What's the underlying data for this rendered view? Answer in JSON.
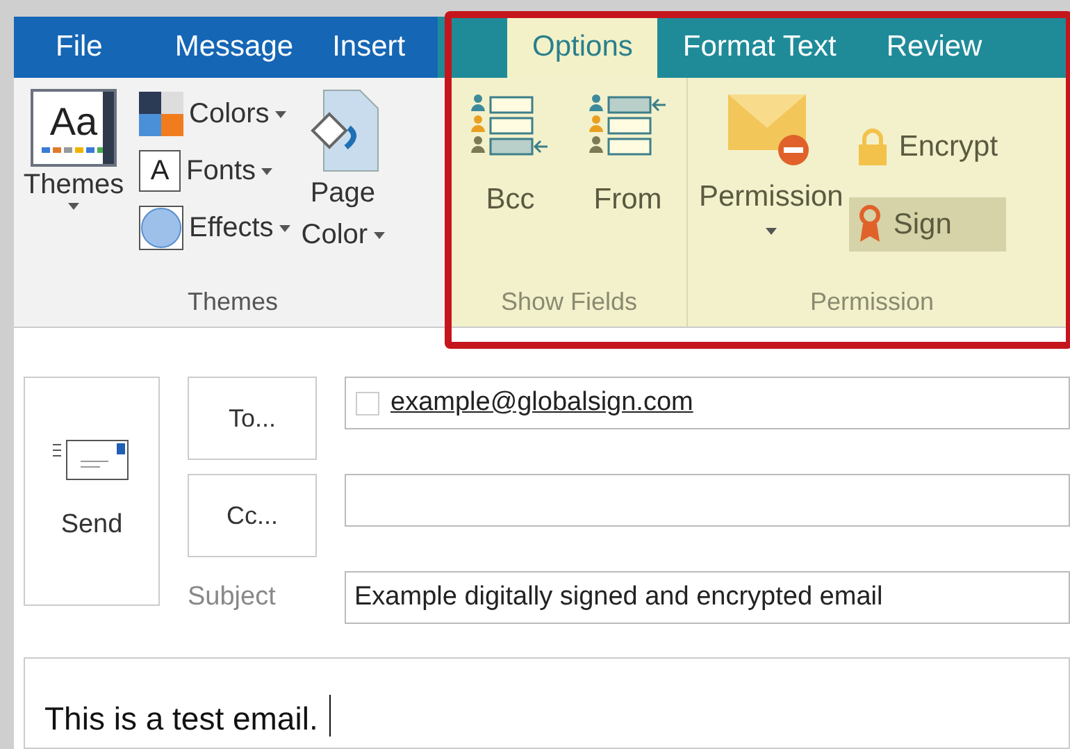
{
  "tabs": [
    {
      "label": "File",
      "selected": false,
      "kind": "main"
    },
    {
      "label": "Message",
      "selected": false,
      "kind": "main"
    },
    {
      "label": "Insert",
      "selected": false,
      "kind": "main"
    },
    {
      "label": "Options",
      "selected": true,
      "kind": "contextual"
    },
    {
      "label": "Format Text",
      "selected": false,
      "kind": "contextual"
    },
    {
      "label": "Review",
      "selected": false,
      "kind": "contextual"
    }
  ],
  "ribbon": {
    "themes_group": {
      "label": "Themes",
      "themes_button": {
        "label": "Themes",
        "icon_text": "Aa"
      },
      "small_buttons": [
        {
          "kind": "colors",
          "label": "Colors"
        },
        {
          "kind": "fonts",
          "label": "Fonts",
          "icon_text": "A"
        },
        {
          "kind": "effects",
          "label": "Effects"
        }
      ],
      "page_color": {
        "label_lines": [
          "Page",
          "Color"
        ]
      }
    },
    "show_fields": {
      "label": "Show Fields",
      "buttons": [
        {
          "kind": "bcc",
          "label": "Bcc"
        },
        {
          "kind": "from",
          "label": "From"
        }
      ]
    },
    "permission": {
      "label": "Permission",
      "permission_button": {
        "label": "Permission"
      },
      "small_buttons": [
        {
          "kind": "encrypt",
          "label": "Encrypt",
          "selected": false
        },
        {
          "kind": "sign",
          "label": "Sign",
          "selected": true
        }
      ]
    }
  },
  "compose": {
    "send_button": "Send",
    "to_button": "To...",
    "to_field": {
      "value": "example@globalsign.com"
    },
    "cc_button": "Cc...",
    "subject_label": "Subject",
    "subject_field": {
      "value": "Example digitally signed and encrypted email"
    },
    "body": "This is a test email."
  }
}
